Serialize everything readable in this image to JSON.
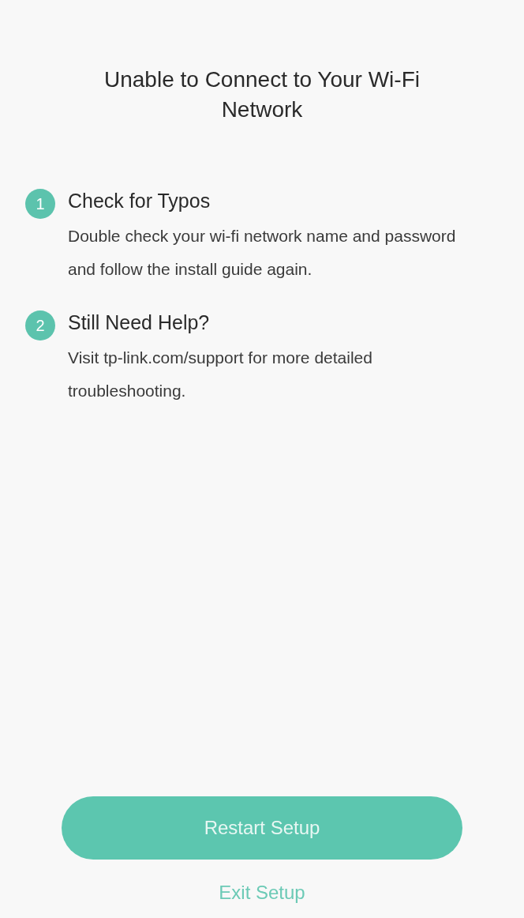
{
  "title": "Unable to Connect to Your Wi-Fi Network",
  "steps": [
    {
      "number": "1",
      "heading": "Check for Typos",
      "text": "Double check your wi-fi network name and password and follow the install guide again."
    },
    {
      "number": "2",
      "heading": "Still Need Help?",
      "text": "Visit tp-link.com/support for more detailed troubleshooting."
    }
  ],
  "primary_button": "Restart Setup",
  "secondary_link": "Exit Setup"
}
